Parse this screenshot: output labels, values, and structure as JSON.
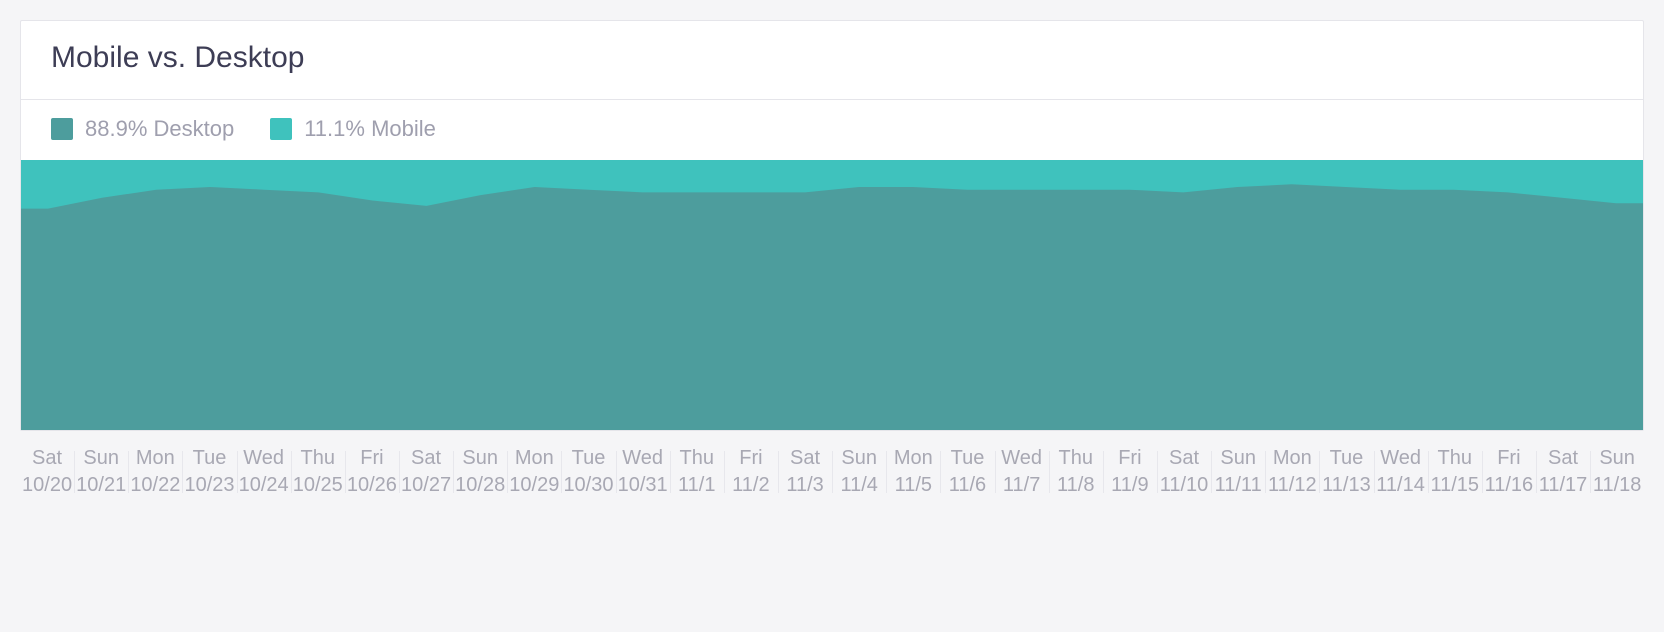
{
  "title": "Mobile vs. Desktop",
  "legend": {
    "desktop": "88.9% Desktop",
    "mobile": "11.1% Mobile"
  },
  "colors": {
    "desktop": "#4d9d9d",
    "mobile": "#3fc2bd"
  },
  "chart_data": {
    "type": "area",
    "title": "Mobile vs. Desktop",
    "xlabel": "",
    "ylabel": "",
    "ylim": [
      0,
      100
    ],
    "stacked": true,
    "legend_position": "top-left",
    "categories": [
      {
        "day": "Sat",
        "date": "10/20"
      },
      {
        "day": "Sun",
        "date": "10/21"
      },
      {
        "day": "Mon",
        "date": "10/22"
      },
      {
        "day": "Tue",
        "date": "10/23"
      },
      {
        "day": "Wed",
        "date": "10/24"
      },
      {
        "day": "Thu",
        "date": "10/25"
      },
      {
        "day": "Fri",
        "date": "10/26"
      },
      {
        "day": "Sat",
        "date": "10/27"
      },
      {
        "day": "Sun",
        "date": "10/28"
      },
      {
        "day": "Mon",
        "date": "10/29"
      },
      {
        "day": "Tue",
        "date": "10/30"
      },
      {
        "day": "Wed",
        "date": "10/31"
      },
      {
        "day": "Thu",
        "date": "11/1"
      },
      {
        "day": "Fri",
        "date": "11/2"
      },
      {
        "day": "Sat",
        "date": "11/3"
      },
      {
        "day": "Sun",
        "date": "11/4"
      },
      {
        "day": "Mon",
        "date": "11/5"
      },
      {
        "day": "Tue",
        "date": "11/6"
      },
      {
        "day": "Wed",
        "date": "11/7"
      },
      {
        "day": "Thu",
        "date": "11/8"
      },
      {
        "day": "Fri",
        "date": "11/9"
      },
      {
        "day": "Sat",
        "date": "11/10"
      },
      {
        "day": "Sun",
        "date": "11/11"
      },
      {
        "day": "Mon",
        "date": "11/12"
      },
      {
        "day": "Tue",
        "date": "11/13"
      },
      {
        "day": "Wed",
        "date": "11/14"
      },
      {
        "day": "Thu",
        "date": "11/15"
      },
      {
        "day": "Fri",
        "date": "11/16"
      },
      {
        "day": "Sat",
        "date": "11/17"
      },
      {
        "day": "Sun",
        "date": "11/18"
      }
    ],
    "series": [
      {
        "name": "Desktop",
        "color": "#4d9d9d",
        "aggregate_pct": 88.9,
        "values": [
          82,
          86,
          89,
          90,
          89,
          88,
          85,
          83,
          87,
          90,
          89,
          88,
          88,
          88,
          88,
          90,
          90,
          89,
          89,
          89,
          89,
          88,
          90,
          91,
          90,
          89,
          89,
          88,
          86,
          84
        ]
      },
      {
        "name": "Mobile",
        "color": "#3fc2bd",
        "aggregate_pct": 11.1,
        "values": [
          18,
          14,
          11,
          10,
          11,
          12,
          15,
          17,
          13,
          10,
          11,
          12,
          12,
          12,
          12,
          10,
          10,
          11,
          11,
          11,
          11,
          12,
          10,
          9,
          10,
          11,
          11,
          12,
          14,
          16
        ]
      }
    ]
  }
}
